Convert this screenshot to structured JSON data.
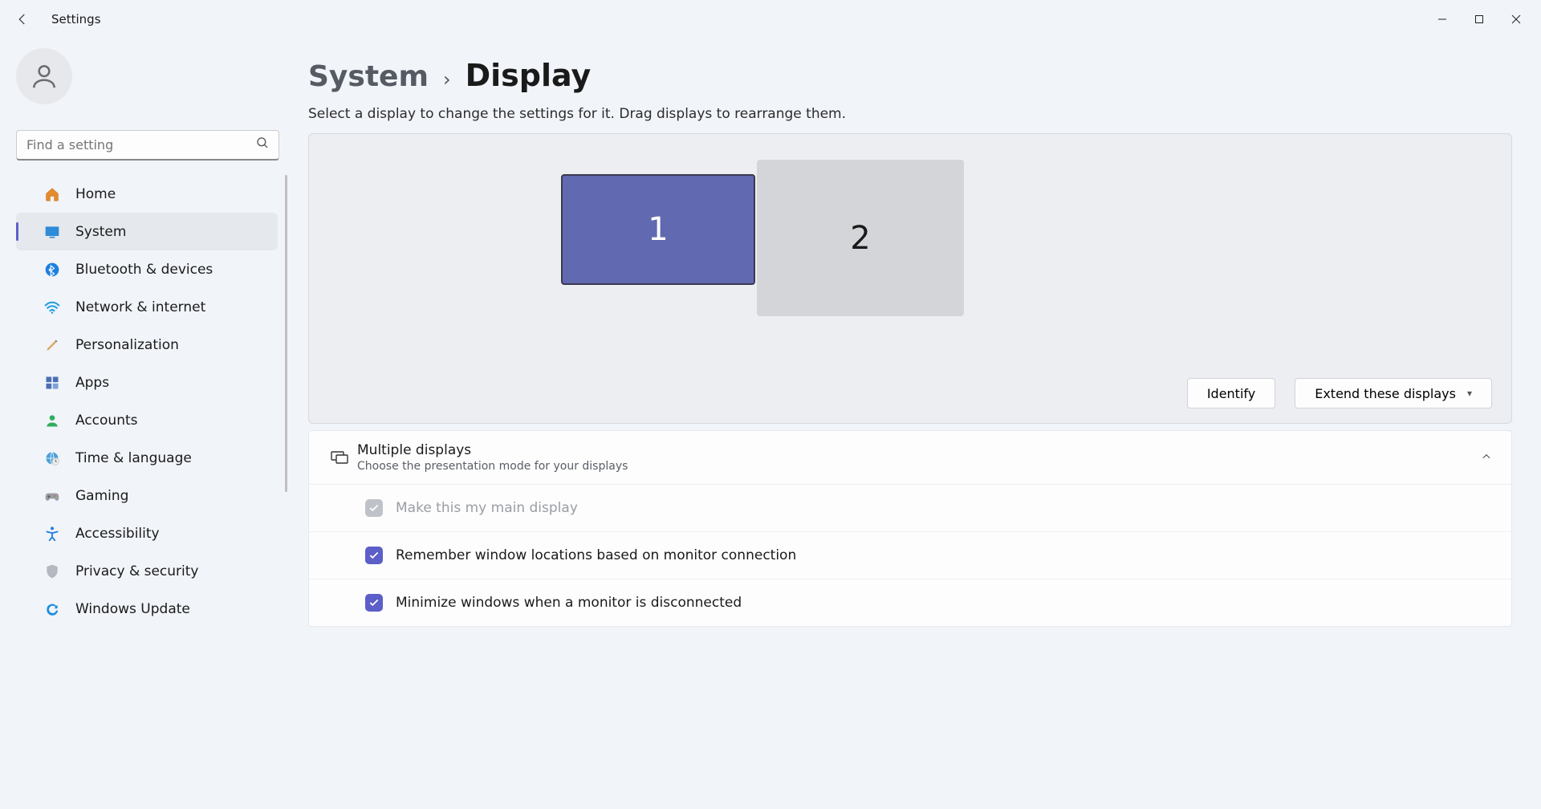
{
  "app_title": "Settings",
  "search_placeholder": "Find a setting",
  "nav": [
    {
      "id": "home",
      "label": "Home"
    },
    {
      "id": "system",
      "label": "System",
      "active": true
    },
    {
      "id": "bluetooth",
      "label": "Bluetooth & devices"
    },
    {
      "id": "network",
      "label": "Network & internet"
    },
    {
      "id": "personalization",
      "label": "Personalization"
    },
    {
      "id": "apps",
      "label": "Apps"
    },
    {
      "id": "accounts",
      "label": "Accounts"
    },
    {
      "id": "time",
      "label": "Time & language"
    },
    {
      "id": "gaming",
      "label": "Gaming"
    },
    {
      "id": "accessibility",
      "label": "Accessibility"
    },
    {
      "id": "privacy",
      "label": "Privacy & security"
    },
    {
      "id": "update",
      "label": "Windows Update"
    }
  ],
  "breadcrumb": {
    "parent": "System",
    "current": "Display"
  },
  "subtitle": "Select a display to change the settings for it. Drag displays to rearrange them.",
  "monitors": {
    "m1": "1",
    "m2": "2"
  },
  "identify_label": "Identify",
  "extend_label": "Extend these displays",
  "multiple_displays": {
    "title": "Multiple displays",
    "desc": "Choose the presentation mode for your displays",
    "options": [
      {
        "label": "Make this my main display",
        "checked": true,
        "disabled": true
      },
      {
        "label": "Remember window locations based on monitor connection",
        "checked": true,
        "disabled": false
      },
      {
        "label": "Minimize windows when a monitor is disconnected",
        "checked": true,
        "disabled": false
      }
    ]
  }
}
